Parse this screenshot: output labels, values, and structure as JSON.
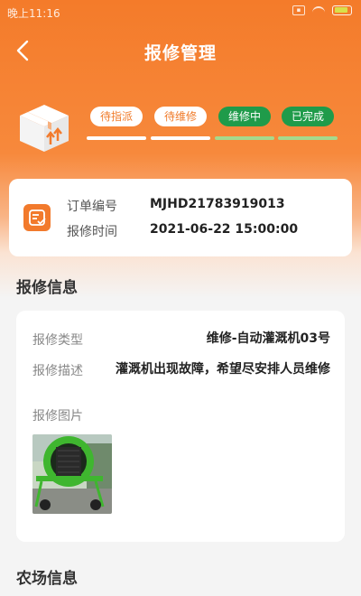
{
  "status_bar": {
    "time": "晚上11:16",
    "icons": [
      "sim-icon",
      "wifi-icon",
      "battery-icon"
    ]
  },
  "header": {
    "title": "报修管理",
    "back_icon": "chevron-left-icon"
  },
  "progress": {
    "icon": "package-box-icon",
    "steps": [
      {
        "label": "待指派",
        "state": "pending"
      },
      {
        "label": "待维修",
        "state": "pending"
      },
      {
        "label": "维修中",
        "state": "active"
      },
      {
        "label": "已完成",
        "state": "active"
      }
    ]
  },
  "order": {
    "icon": "order-checklist-icon",
    "number_label": "订单编号",
    "number_value": "MJHD21783919013",
    "time_label": "报修时间",
    "time_value": "2021-06-22 15:00:00"
  },
  "repair_info": {
    "section_title": "报修信息",
    "type_label": "报修类型",
    "type_value": "维修-自动灌溉机03号",
    "desc_label": "报修描述",
    "desc_value": "灌溉机出现故障，希望尽安排人员维修",
    "image_label": "报修图片"
  },
  "farm_info": {
    "section_title": "农场信息"
  },
  "colors": {
    "brand_orange": "#f47b2a",
    "step_active_green": "#1f9b4a"
  }
}
